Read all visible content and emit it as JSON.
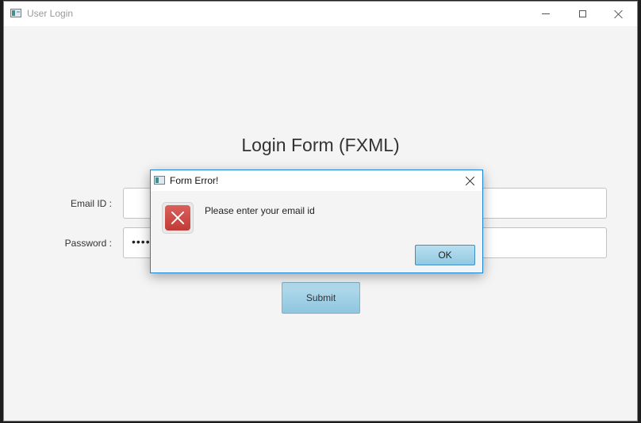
{
  "window": {
    "title": "User Login",
    "icon": "app-window-icon"
  },
  "form": {
    "title": "Login Form (FXML)",
    "email_label": "Email ID :",
    "email_value": "",
    "password_label": "Password :",
    "password_value": "••••",
    "submit_label": "Submit"
  },
  "dialog": {
    "title": "Form Error!",
    "message": "Please enter your email id",
    "ok_label": "OK",
    "icon": "error-icon"
  },
  "colors": {
    "accent": "#1883d7",
    "button": "#a9d4e8",
    "error": "#c94540"
  }
}
